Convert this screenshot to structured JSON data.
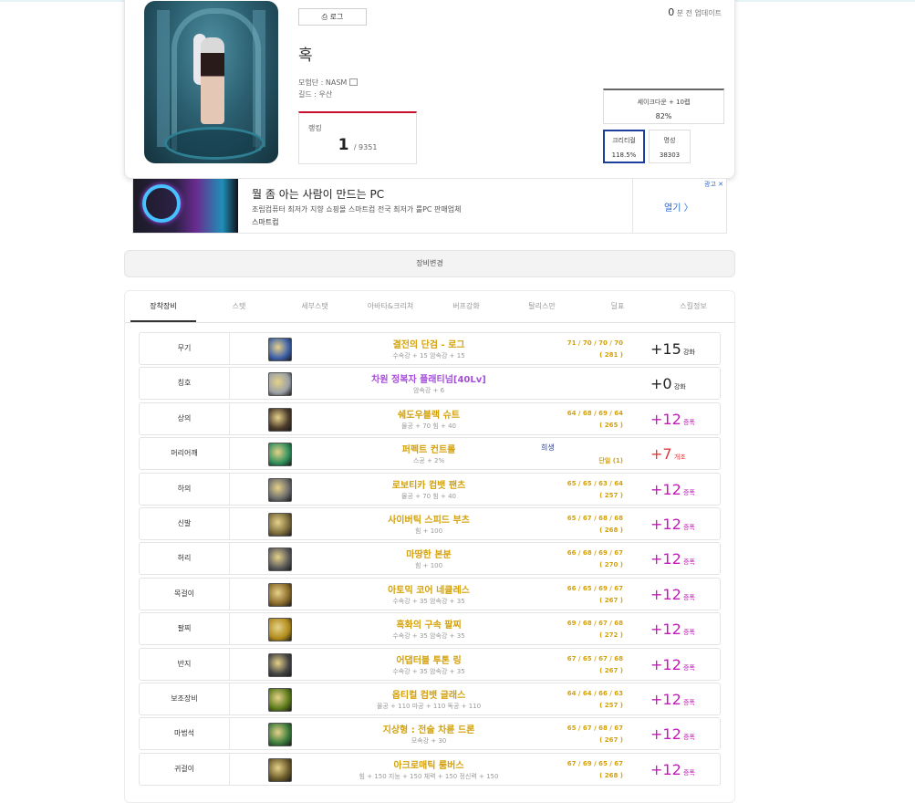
{
  "card": {
    "log_button": "⎙ 로그",
    "update_count": "0",
    "update_text": "분 전 업데이트",
    "char_name": "혹",
    "adventure_line": "모험단 : NASM",
    "guild_line": "길드 : 우산",
    "rank_label": "랭킹",
    "rank_value": "1",
    "rank_total": "/ 9351",
    "buff_title": "세이크다운 + 10렙",
    "buff_value": "82%",
    "critical_label": "크리티컬",
    "critical_value": "118.5%",
    "fame_label": "명성",
    "fame_value": "38303"
  },
  "ad": {
    "headline": "뭘 좀 아는 사람이 만드는 PC",
    "desc": "조립컴퓨터 최저가 지향 쇼핑몰 스마트컴 전국 최저가 룰PC 판매업체",
    "brand": "스마트컴",
    "open": "열기 〉",
    "tag": "광고 ✕"
  },
  "equip_change": "장비변경",
  "tabs": [
    "장착장비",
    "스탯",
    "세부스탯",
    "아바타&크리쳐",
    "버프강화",
    "탈리스만",
    "딜표",
    "스킬정보"
  ],
  "colors": {
    "gold": "#d4a10a",
    "purple": "#a54fd8",
    "amp": "#c21bb8",
    "red": "#e03a3a",
    "active_border": "#1c3f9b"
  },
  "equipment": [
    {
      "slot": "무기",
      "name": "결전의 단검 - 로그",
      "sub": "수속강 + 15 암속강 + 15",
      "nums": "71 / 70 / 70 / 70",
      "total": "( 281 )",
      "enh": "+15",
      "enh_type": "강화",
      "icon": "dagger-icon",
      "icon_color": "#3b5fa8"
    },
    {
      "slot": "칭호",
      "name": "차원 정복자 플래티넘[40Lv]",
      "sub": "암속강 + 6",
      "nums": "",
      "total": "",
      "enh": "+0",
      "enh_type": "강화",
      "icon": "title-icon",
      "icon_color": "#9aa0a6"
    },
    {
      "slot": "상의",
      "name": "쉐도우블랙 슈트",
      "sub": "물공 + 70 힘 + 40",
      "nums": "64 / 68 / 69 / 64",
      "total": "( 265 )",
      "enh": "+12",
      "enh_type": "증폭",
      "icon": "top-armor-icon",
      "icon_color": "#4a3a2a"
    },
    {
      "slot": "머리어깨",
      "name": "퍼펙트 컨트롤",
      "sub": "스공 + 2%",
      "nums": "",
      "total": "단일 (1)",
      "enh": "+7",
      "enh_type": "개조",
      "extra": "희생",
      "icon": "shoulder-icon",
      "icon_color": "#2f8f5a"
    },
    {
      "slot": "하의",
      "name": "로보티카 컴뱃 팬츠",
      "sub": "물공 + 70 힘 + 40",
      "nums": "65 / 65 / 63 / 64",
      "total": "( 257 )",
      "enh": "+12",
      "enh_type": "증폭",
      "icon": "pants-icon",
      "icon_color": "#6b6b6b"
    },
    {
      "slot": "신발",
      "name": "사이버틱 스피드 부츠",
      "sub": "힘 + 100",
      "nums": "65 / 67 / 68 / 68",
      "total": "( 268 )",
      "enh": "+12",
      "enh_type": "증폭",
      "icon": "boots-icon",
      "icon_color": "#7a6a3a"
    },
    {
      "slot": "허리",
      "name": "마땅한 본분",
      "sub": "힘 + 100",
      "nums": "66 / 68 / 69 / 67",
      "total": "( 270 )",
      "enh": "+12",
      "enh_type": "증폭",
      "icon": "belt-icon",
      "icon_color": "#5a5a5a"
    },
    {
      "slot": "목걸이",
      "name": "아토믹 코어 네클레스",
      "sub": "수속강 + 35 암속강 + 35",
      "nums": "66 / 65 / 69 / 67",
      "total": "( 267 )",
      "enh": "+12",
      "enh_type": "증폭",
      "icon": "necklace-icon",
      "icon_color": "#8a6a2a"
    },
    {
      "slot": "팔찌",
      "name": "흑화의 구속 팔찌",
      "sub": "수속강 + 35 암속강 + 35",
      "nums": "69 / 68 / 67 / 68",
      "total": "( 272 )",
      "enh": "+12",
      "enh_type": "증폭",
      "icon": "bracelet-icon",
      "icon_color": "#b08a1a"
    },
    {
      "slot": "반지",
      "name": "어댑터블 투톤 링",
      "sub": "수속강 + 35 암속강 + 35",
      "nums": "67 / 65 / 67 / 68",
      "total": "( 267 )",
      "enh": "+12",
      "enh_type": "증폭",
      "icon": "ring-icon",
      "icon_color": "#444444"
    },
    {
      "slot": "보조장비",
      "name": "옵티컬 컴뱃 글래스",
      "sub": "물공 + 110 마공 + 110 독공 + 110",
      "nums": "64 / 64 / 66 / 63",
      "total": "( 257 )",
      "enh": "+12",
      "enh_type": "증폭",
      "icon": "glasses-icon",
      "icon_color": "#5a7a1a"
    },
    {
      "slot": "마법석",
      "name": "지상형 : 전술 차륜 드론",
      "sub": "모속강 + 30",
      "nums": "65 / 67 / 68 / 67",
      "total": "( 267 )",
      "enh": "+12",
      "enh_type": "증폭",
      "icon": "drone-icon",
      "icon_color": "#3a7a3a"
    },
    {
      "slot": "귀걸이",
      "name": "아크로매틱 룸버스",
      "sub": "힘 + 150 지능 + 150 체력 + 150 정신력 + 150",
      "nums": "67 / 69 / 65 / 67",
      "total": "( 268 )",
      "enh": "+12",
      "enh_type": "증폭",
      "icon": "earring-icon",
      "icon_color": "#6a5a2a"
    }
  ]
}
